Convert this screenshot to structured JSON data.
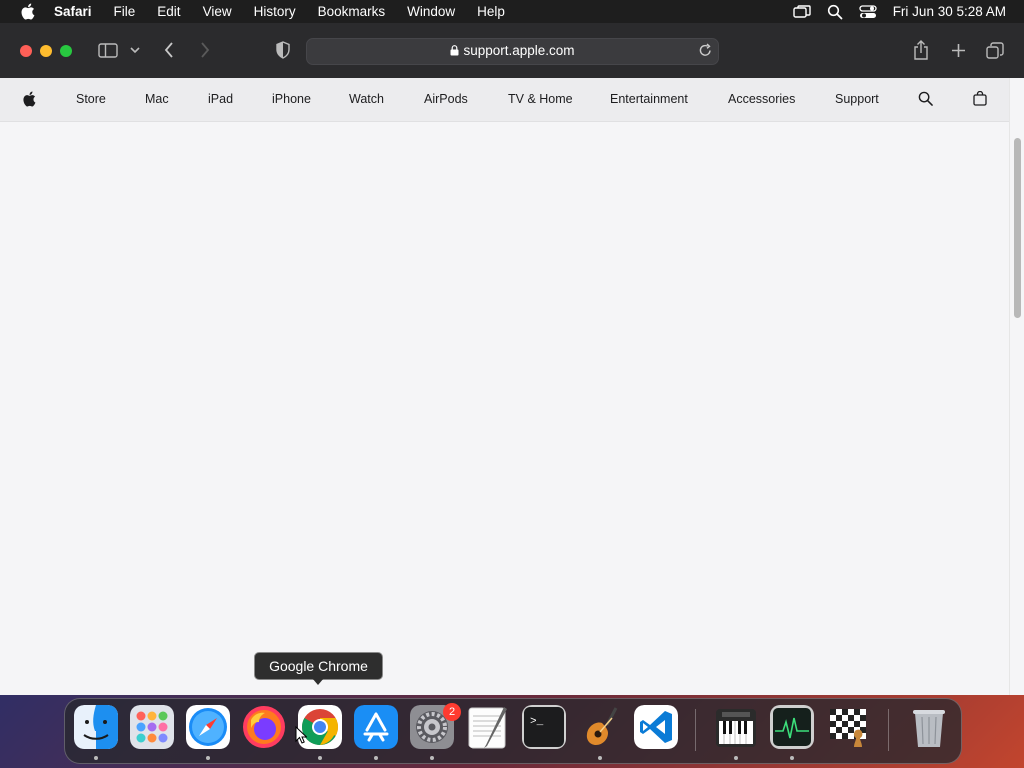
{
  "menubar": {
    "app_name": "Safari",
    "menus": [
      "File",
      "Edit",
      "View",
      "History",
      "Bookmarks",
      "Window",
      "Help"
    ],
    "clock": "Fri Jun 30  5:28 AM",
    "right_icons": [
      "screen-mirroring-icon",
      "spotlight-search-icon",
      "control-center-icon"
    ]
  },
  "safari": {
    "url": "support.apple.com",
    "traffic_light_colors": {
      "close": "#fe5f57",
      "minimize": "#febc2e",
      "zoom": "#28c840"
    }
  },
  "apple_nav": {
    "items": [
      "Store",
      "Mac",
      "iPad",
      "iPhone",
      "Watch",
      "AirPods",
      "TV & Home",
      "Entertainment",
      "Accessories",
      "Support"
    ]
  },
  "tooltip": {
    "text": "Google Chrome"
  },
  "dock": {
    "apps": [
      {
        "name": "Finder",
        "icon": "finder-icon",
        "running": true
      },
      {
        "name": "Launchpad",
        "icon": "launchpad-icon",
        "running": false
      },
      {
        "name": "Safari",
        "icon": "safari-icon",
        "running": true
      },
      {
        "name": "Firefox",
        "icon": "firefox-icon",
        "running": false
      },
      {
        "name": "Google Chrome",
        "icon": "chrome-icon",
        "running": true
      },
      {
        "name": "App Store",
        "icon": "app-store-icon",
        "running": true
      },
      {
        "name": "System Settings",
        "icon": "system-settings-icon",
        "running": true,
        "badge": "2"
      },
      {
        "name": "TextEdit",
        "icon": "textedit-icon",
        "running": false
      },
      {
        "name": "Terminal",
        "icon": "terminal-icon",
        "running": false
      },
      {
        "name": "GarageBand",
        "icon": "garageband-icon",
        "running": true
      },
      {
        "name": "Visual Studio Code",
        "icon": "vscode-icon",
        "running": false
      },
      {
        "name": "MIDI Keyboard",
        "icon": "piano-icon",
        "running": true
      },
      {
        "name": "Activity Monitor",
        "icon": "activity-monitor-icon",
        "running": true
      },
      {
        "name": "Chess",
        "icon": "chess-icon",
        "running": false
      },
      {
        "name": "Trash",
        "icon": "trash-icon",
        "running": false
      }
    ]
  }
}
